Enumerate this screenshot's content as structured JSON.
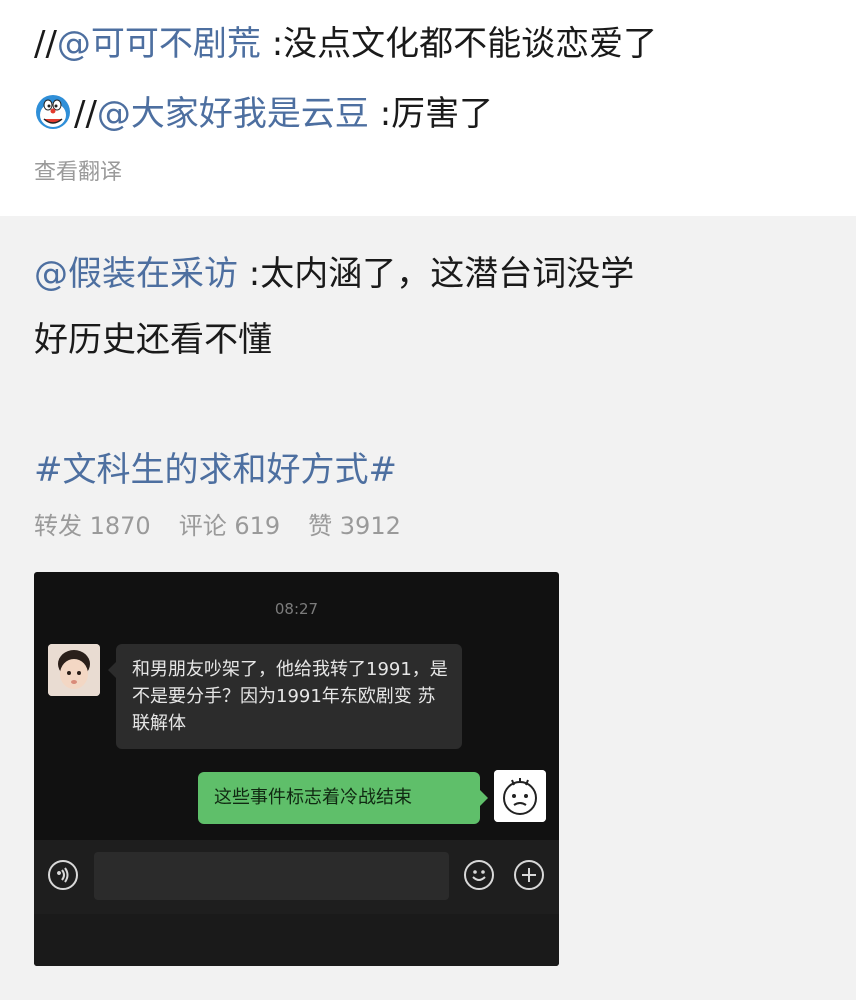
{
  "post": {
    "line1": {
      "prefix": "//",
      "mention": "@可可不剧荒",
      "text": " :没点文化都不能谈恋爱了"
    },
    "line2": {
      "emoji_icon": "doraemon-face-icon",
      "prefix": "//",
      "mention": "@大家好我是云豆",
      "text": " :厉害了"
    },
    "translate_label": "查看翻译"
  },
  "original": {
    "mention": "@假装在采访",
    "text_line1": " :太内涵了，这潜台词没学",
    "text_line2": "好历史还看不懂",
    "hashtag": "#文科生的求和好方式#",
    "stats": {
      "repost": "转发 1870",
      "comment": "评论 619",
      "like": "赞 3912"
    }
  },
  "chat": {
    "time": "08:27",
    "incoming_message": "和男朋友吵架了，他给我转了1991，是不是要分手？因为1991年东欧剧变 苏联解体",
    "outgoing_message": "这些事件标志着冷战结束",
    "icons": {
      "voice": "voice-icon",
      "emoji": "smile-icon",
      "more": "plus-icon"
    }
  },
  "colors": {
    "link": "#4d6fa0",
    "muted": "#9a9a9a",
    "chat_bg": "#111111",
    "bubble_green": "#5fbf6a"
  }
}
